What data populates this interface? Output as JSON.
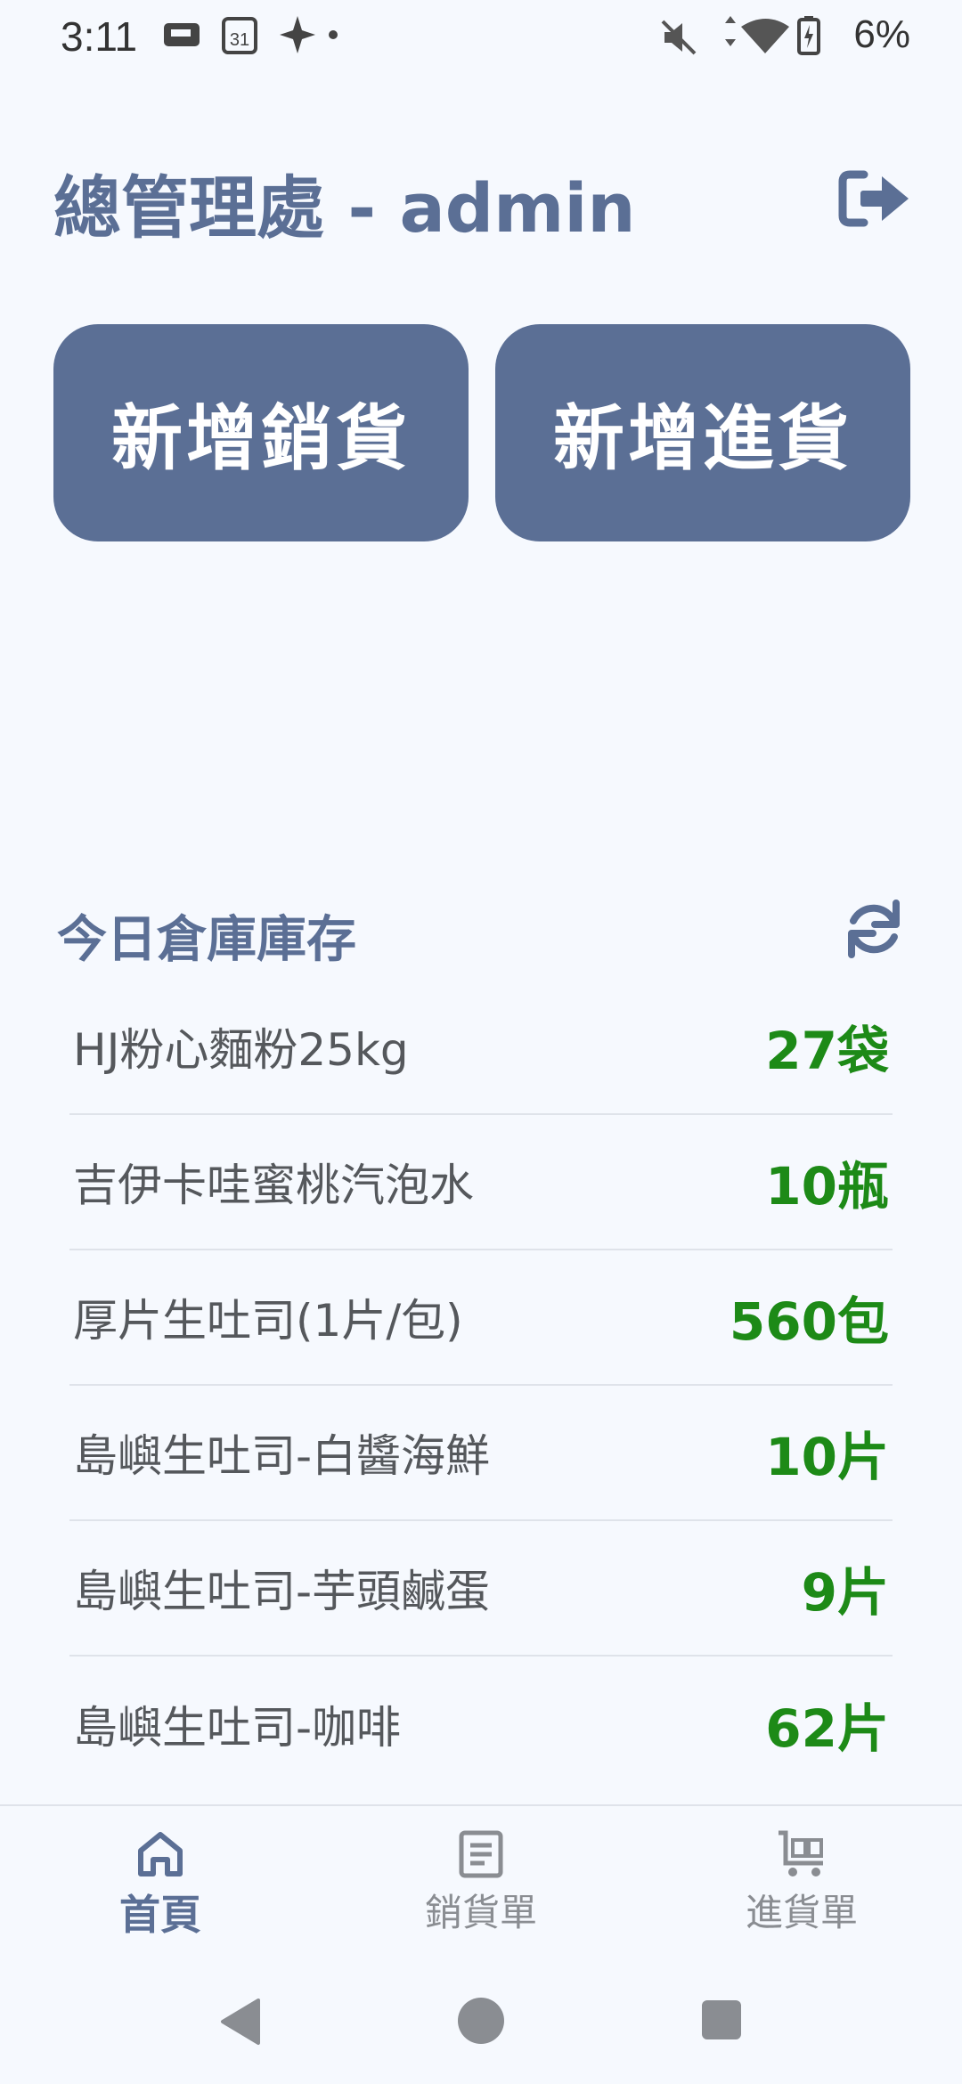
{
  "status_bar": {
    "time": "3:11",
    "calendar_day": "31",
    "battery": "6%"
  },
  "header": {
    "title": "總管理處 - admin"
  },
  "actions": {
    "new_sale": "新增銷貨",
    "new_purchase": "新增進貨"
  },
  "inventory": {
    "title": "今日倉庫庫存",
    "items": [
      {
        "name": "HJ粉心麵粉25kg",
        "qty": "27袋"
      },
      {
        "name": "吉伊卡哇蜜桃汽泡水",
        "qty": "10瓶"
      },
      {
        "name": "厚片生吐司(1片/包)",
        "qty": "560包"
      },
      {
        "name": "島嶼生吐司-白醬海鮮",
        "qty": "10片"
      },
      {
        "name": "島嶼生吐司-芋頭鹹蛋",
        "qty": "9片"
      },
      {
        "name": "島嶼生吐司-咖啡",
        "qty": "62片"
      }
    ]
  },
  "bottom_nav": {
    "home": "首頁",
    "sales": "銷貨單",
    "purchases": "進貨單"
  },
  "colors": {
    "primary": "#5b6f95",
    "qty_green": "#1d8a17",
    "background": "#f6f9fe"
  }
}
